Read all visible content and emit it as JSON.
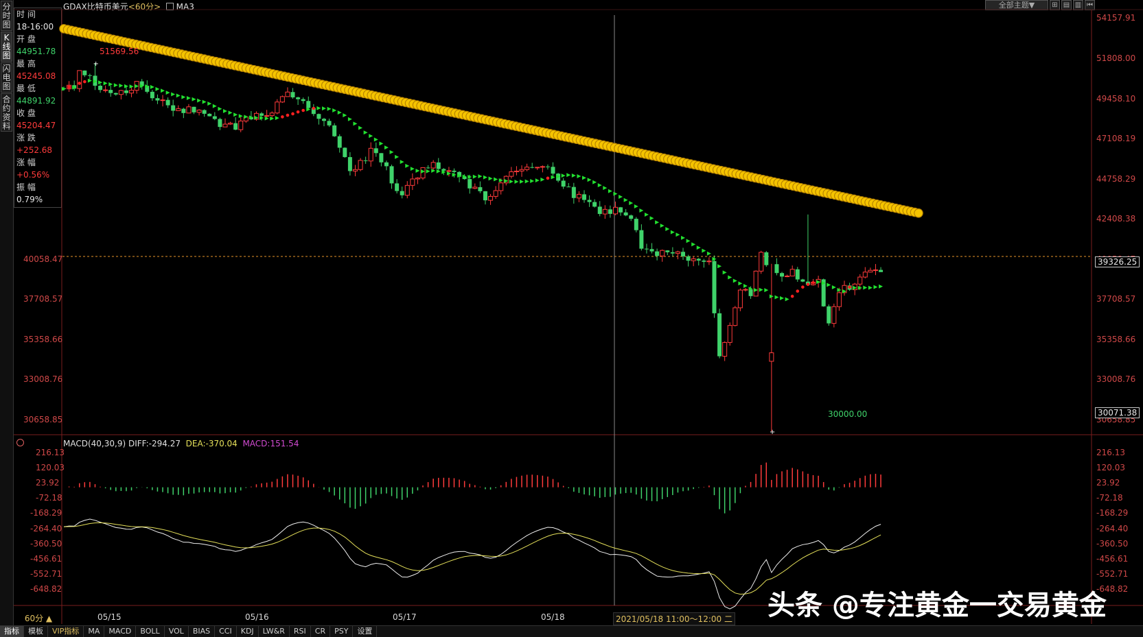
{
  "window": {
    "symbol": "GDAX比特币美元",
    "period": "<60分>",
    "indicator": "MA3",
    "theme_button": "全部主题▼"
  },
  "left_tabs": [
    {
      "label": "分时图",
      "active": false
    },
    {
      "label": "K线图",
      "active": true
    },
    {
      "label": "闪电图",
      "active": false
    },
    {
      "label": "合约资料",
      "active": false
    }
  ],
  "info_panel": {
    "time_label": "时 间",
    "time_value": "18-16:00",
    "open_label": "开 盘",
    "open_value": "44951.78",
    "high_label": "最 高",
    "high_value": "45245.08",
    "low_label": "最 低",
    "low_value": "44891.92",
    "close_label": "收 盘",
    "close_value": "45204.47",
    "change_label": "涨 跌",
    "change_value": "+252.68",
    "pct_label": "涨 幅",
    "pct_value": "+0.56%",
    "amp_label": "振 幅",
    "amp_value": "0.79%",
    "hidden_partial": "42408.38"
  },
  "price_axis": {
    "ticks": [
      "54157.91",
      "51808.00",
      "49458.10",
      "47108.19",
      "44758.29",
      "42408.38",
      "40058.47",
      "37708.57",
      "35358.66",
      "33008.76",
      "30658.85"
    ],
    "left_ticks": [
      "40058.47",
      "37708.57",
      "35358.66",
      "33008.76",
      "30658.85"
    ],
    "current_price": "39326.25",
    "bottom_price": "30071.38",
    "high_marker": "51569.56",
    "low_marker": "30000.00"
  },
  "macd": {
    "header_name": "MACD(40,30,9)",
    "diff_text": "DIFF:-294.27",
    "dea_text": "DEA:-370.04",
    "macd_text": "MACD:151.54",
    "ticks": [
      "216.13",
      "120.03",
      "23.92",
      "-72.18",
      "-168.29",
      "-264.40",
      "-360.50",
      "-456.61",
      "-552.71",
      "-648.82"
    ]
  },
  "x_axis": {
    "labels": [
      "05/15",
      "05/16",
      "05/17",
      "05/18"
    ],
    "crosshair_date": "2021/05/18 11:00～12:00 二",
    "period_button": "60分 ▲"
  },
  "bottom_tabs": [
    "指标",
    "模板",
    "VIP指标",
    "MA",
    "MACD",
    "BOLL",
    "VOL",
    "BIAS",
    "CCI",
    "KDJ",
    "LW&R",
    "RSI",
    "CR",
    "PSY",
    "设置"
  ],
  "watermark": "头条 @专注黄金一交易黄金",
  "colors": {
    "up": "#ff3b3b",
    "down": "#3fd26a",
    "ma_long": "#f5c400",
    "ma_mid": "#22e030",
    "ma_short": "#ff2020",
    "diff_line": "#f0f0f0",
    "dea_line": "#e5e05a"
  },
  "chart_data": {
    "type": "candlestick",
    "title": "GDAX比特币美元 <60分>",
    "y_range": [
      30071.38,
      54157.91
    ],
    "x_day_labels": [
      "05/15",
      "05/16",
      "05/17",
      "05/18"
    ],
    "ohlc_sample": {
      "start_open": 50200,
      "high": 51569.56,
      "low": 30000.0,
      "last_close": 39326.25
    },
    "ma_long": {
      "start": 53500,
      "end": 42700
    },
    "macd_y_range": [
      -648.82,
      216.13
    ]
  }
}
